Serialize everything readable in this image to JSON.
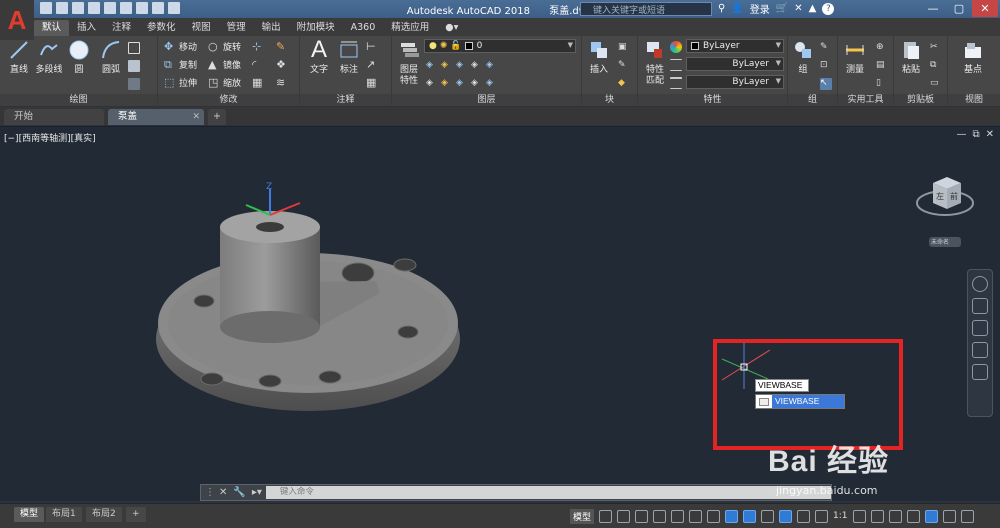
{
  "title_bar": {
    "app_name": "Autodesk AutoCAD 2018",
    "file_name": "泵盖.dwg",
    "search_placeholder": "键入关键字或短语",
    "sign_in": "登录"
  },
  "ribbon_tabs": [
    "默认",
    "插入",
    "注释",
    "参数化",
    "视图",
    "管理",
    "输出",
    "附加模块",
    "A360",
    "精选应用"
  ],
  "ribbon": {
    "draw": {
      "title": "绘图",
      "line": "直线",
      "polyline": "多段线",
      "circle": "圆",
      "arc": "圆弧"
    },
    "modify": {
      "title": "修改",
      "move": "移动",
      "rotate": "旋转",
      "copy": "复制",
      "mirror": "镜像",
      "stretch": "拉伸",
      "scale": "缩放"
    },
    "annotation": {
      "title": "注释",
      "text": "文字",
      "dimension": "标注"
    },
    "layers": {
      "title": "图层",
      "layer_props_line1": "图层",
      "layer_props_line2": "特性",
      "current_layer": "0"
    },
    "block": {
      "title": "块",
      "insert": "插入"
    },
    "properties": {
      "title": "特性",
      "match_line1": "特性",
      "match_line2": "匹配",
      "color": "ByLayer",
      "linetype": "ByLayer",
      "lineweight": "ByLayer"
    },
    "groups": {
      "title": "组",
      "group": "组"
    },
    "utilities": {
      "title": "实用工具",
      "measure": "测量"
    },
    "clipboard": {
      "title": "剪贴板",
      "paste": "粘贴"
    },
    "view": {
      "title": "视图",
      "base": "基点"
    }
  },
  "doc_tabs": [
    "开始",
    "泵盖"
  ],
  "viewport": {
    "label": "[−][西南等轴测][真实]",
    "viewcube_left": "左",
    "viewcube_front": "前",
    "viewcube_wcs": "未命名"
  },
  "command": {
    "input_value": "VIEWBASE",
    "suggestion": "VIEWBASE",
    "prompt_placeholder": "键入命令"
  },
  "status_bar": {
    "tabs": [
      "模型",
      "布局1",
      "布局2"
    ],
    "model_label": "模型",
    "scale": "1:1"
  },
  "watermark": {
    "brand": "Bai 经验",
    "url": "jingyan.baidu.com"
  },
  "colors": {
    "highlight_box": "#e42323",
    "viewport_bg": "#222a35",
    "ribbon_bg": "#474747",
    "accent_blue": "#3c78d8"
  }
}
